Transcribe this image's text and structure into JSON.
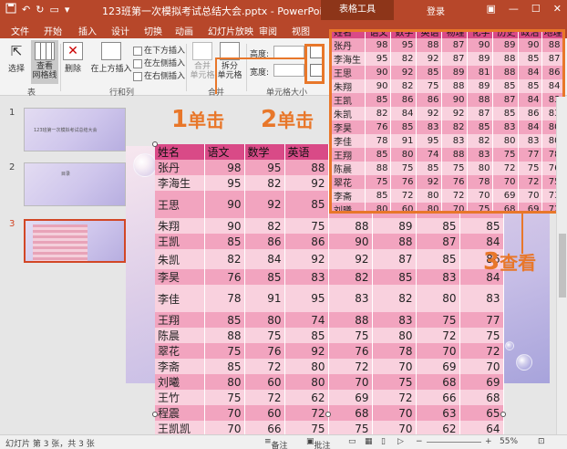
{
  "window": {
    "title": "123班第一次模拟考试总结大会.pptx - PowerPoint",
    "context_group": "表格工具",
    "login": "登录",
    "qat": {
      "save_icon": "save-icon",
      "undo_icon": "undo-icon",
      "redo_icon": "redo-icon"
    }
  },
  "tabs": [
    "文件",
    "开始",
    "插入",
    "设计",
    "切换",
    "动画",
    "幻灯片放映",
    "审阅",
    "视图"
  ],
  "ribbon": {
    "select_label": "选择",
    "gridlines_label": "查看\n网格线",
    "delete_label": "删除",
    "insert_above_label": "在上方插入",
    "insert_below_label": "在下方插入",
    "insert_left_label": "在左侧插入",
    "insert_right_label": "在右侧插入",
    "merge_cells_label": "合并\n单元格",
    "split_cells_label": "拆分\n单元格",
    "height_label": "高度:",
    "width_label": "宽度:",
    "group_table": "表",
    "group_rows_cols": "行和列",
    "group_merge": "合并",
    "group_cell_size": "单元格大小"
  },
  "slides": [
    {
      "num": "1",
      "text": "123班第一次模拟考试总结大会"
    },
    {
      "num": "2",
      "text": "目录"
    },
    {
      "num": "3",
      "text": ""
    }
  ],
  "annotations": {
    "step1_num": "1",
    "step1_label": "单击",
    "step2_num": "2",
    "step2_label": "单击",
    "step3_num": "3",
    "step3_label": "查看"
  },
  "table": {
    "headers": [
      "姓名",
      "语文",
      "数学",
      "英语",
      "物理",
      "化学",
      "历史",
      "政治",
      "地理"
    ],
    "rows": [
      [
        "张丹",
        "98",
        "95",
        "88",
        "87",
        "90",
        "89",
        "90",
        "88"
      ],
      [
        "李海生",
        "95",
        "82",
        "92",
        "87",
        "89",
        "88",
        "85",
        "87"
      ],
      [
        "王思",
        "90",
        "92",
        "85",
        "89",
        "81",
        "88",
        "84",
        "86"
      ],
      [
        "朱翔",
        "90",
        "82",
        "75",
        "88",
        "89",
        "85",
        "85",
        "84"
      ],
      [
        "王凯",
        "85",
        "86",
        "86",
        "90",
        "88",
        "87",
        "84",
        "83"
      ],
      [
        "朱凯",
        "82",
        "84",
        "92",
        "92",
        "87",
        "85",
        "86",
        "83"
      ],
      [
        "李昊",
        "76",
        "85",
        "83",
        "82",
        "85",
        "83",
        "84",
        "80"
      ],
      [
        "李佳",
        "78",
        "91",
        "95",
        "83",
        "82",
        "80",
        "83",
        "80"
      ],
      [
        "王翔",
        "85",
        "80",
        "74",
        "88",
        "83",
        "75",
        "77",
        "78"
      ],
      [
        "陈晨",
        "88",
        "75",
        "85",
        "75",
        "80",
        "72",
        "75",
        "76"
      ],
      [
        "翠花",
        "75",
        "76",
        "92",
        "76",
        "78",
        "70",
        "72",
        "75"
      ],
      [
        "李斋",
        "85",
        "72",
        "80",
        "72",
        "70",
        "69",
        "70",
        "73"
      ],
      [
        "刘曦",
        "80",
        "60",
        "80",
        "70",
        "75",
        "68",
        "69",
        "72"
      ],
      [
        "王竹",
        "75",
        "72",
        "62",
        "69",
        "72",
        "66",
        "68",
        "71"
      ],
      [
        "程震",
        "70",
        "60",
        "72",
        "68",
        "70",
        "63",
        "65",
        "70"
      ],
      [
        "王凯凯",
        "70",
        "66",
        "75",
        "75",
        "70",
        "62",
        "64",
        "69"
      ]
    ]
  },
  "status": {
    "slide_info": "幻灯片 第 3 张，共 3 张",
    "notes_label": "备注",
    "comments_label": "批注",
    "zoom": "55%"
  },
  "colors": {
    "accent": "#e8772a",
    "ribbon": "#b7472a",
    "header_row": "#d94a87",
    "odd_row": "#f2a4bf",
    "even_row": "#f9d1de"
  }
}
